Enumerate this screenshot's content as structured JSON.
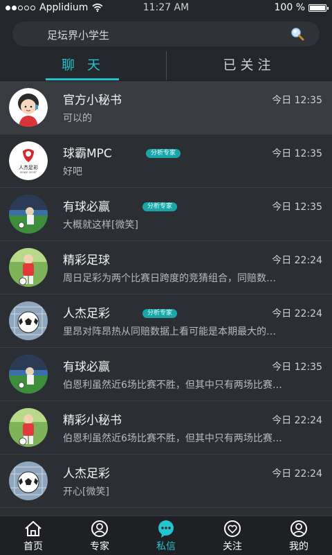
{
  "status_bar": {
    "carrier": "Applidium",
    "time": "11:27 AM",
    "battery": "100 %"
  },
  "search": {
    "text": "足坛界小学生"
  },
  "tabs": [
    {
      "label": "聊 天"
    },
    {
      "label": "已关注"
    }
  ],
  "conversations": [
    {
      "name": "官方小秘书",
      "time": "今日 12:35",
      "message": "可以的",
      "badge": ""
    },
    {
      "name": "球霸MPC",
      "time": "今日 12:35",
      "message": "好吧",
      "badge": "分析专家"
    },
    {
      "name": "有球必赢",
      "time": "今日 12:35",
      "message": "大概就这样[微笑]",
      "badge": "分析专家"
    },
    {
      "name": "精彩足球",
      "time": "今日 22:24",
      "message": "周日足彩为两个比赛日跨度的竞猜组合，同赔数…",
      "badge": ""
    },
    {
      "name": "人杰足彩",
      "time": "今日 22:24",
      "message": "里昂对阵昂热从同赔数据上看可能是本期最大的…",
      "badge": "分析专家"
    },
    {
      "name": "有球必赢",
      "time": "今日 12:35",
      "message": "伯恩利虽然近6场比赛不胜，但其中只有两场比赛…",
      "badge": ""
    },
    {
      "name": "精彩小秘书",
      "time": "今日 22:24",
      "message": "伯恩利虽然近6场比赛不胜，但其中只有两场比赛…",
      "badge": ""
    },
    {
      "name": "人杰足彩",
      "time": "今日 22:24",
      "message": "开心[微笑]",
      "badge": ""
    }
  ],
  "bottom_nav": [
    {
      "label": "首页",
      "icon": "home-icon"
    },
    {
      "label": "专家",
      "icon": "expert-icon"
    },
    {
      "label": "私信",
      "icon": "message-icon"
    },
    {
      "label": "关注",
      "icon": "heart-icon"
    },
    {
      "label": "我的",
      "icon": "profile-icon"
    }
  ],
  "colors": {
    "accent": "#23c3cf",
    "badge": "#1aa6a8",
    "background": "#2b2e33"
  }
}
